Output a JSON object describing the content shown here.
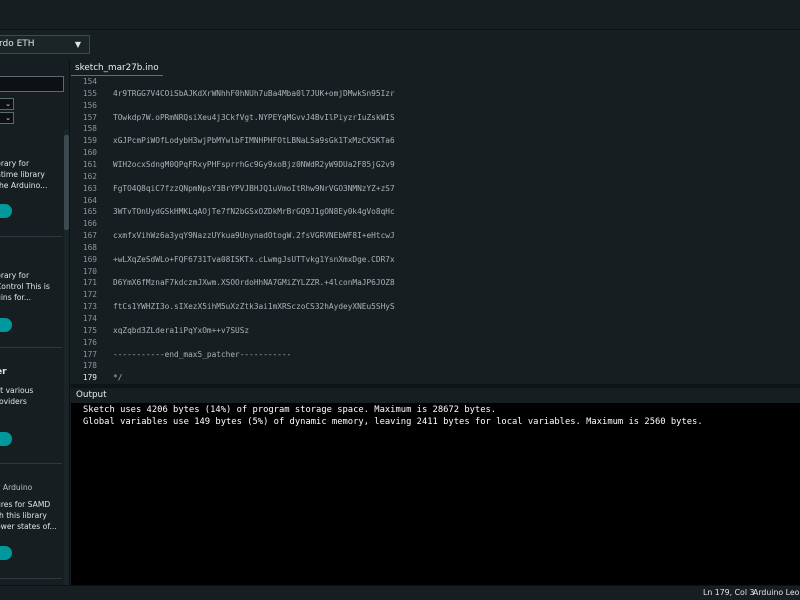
{
  "toolbar": {
    "board_selector": "rdo ETH"
  },
  "sidebar": {
    "filter_options": [
      "",
      ""
    ],
    "cards": [
      {
        "lines": [
          "brary for",
          "ntime library",
          "the Arduino..."
        ]
      },
      {
        "lines": [
          "brary for",
          "Control This is",
          "gins for..."
        ]
      },
      {
        "title": "er",
        "lines": [
          "ct various",
          "roviders"
        ]
      },
      {
        "subtitle": "y Arduino",
        "lines": [
          "ures for SAMD",
          "th this library",
          "ower states of..."
        ]
      }
    ]
  },
  "editor": {
    "tab_name": "sketch_mar27b.ino",
    "lines": [
      {
        "num": "154",
        "code": ""
      },
      {
        "num": "155",
        "code": "4r9TRGG7V4COiSbAJKdXrWNhhF0hNUh7uBa4Mba0l7JUK+omjDMwkSn95Izr"
      },
      {
        "num": "156",
        "code": ""
      },
      {
        "num": "157",
        "code": "TOwkdp7W.oPRmNRQsiXeu4j3CkfVgt.NYPEYqMGvvJ4BvIlPiyzrIuZskWIS"
      },
      {
        "num": "158",
        "code": ""
      },
      {
        "num": "159",
        "code": "xGJPcmPiWOfLodybH3wjPbMYwlbFIMNHPHFOtLBNaLSa9sGk1TxMzCXSKTa6"
      },
      {
        "num": "160",
        "code": ""
      },
      {
        "num": "161",
        "code": "WIH2ocxSdngM0QPqFRxyPHFsprrhGc9Gy9xoBjz0NWdR2yW9DUa2F85jG2v9"
      },
      {
        "num": "162",
        "code": ""
      },
      {
        "num": "163",
        "code": "FgTO4Q8qiC7fzzQNpmNpsY3BrYPVJBHJQ1uVmoItRhw9NrVGO3NMNzYZ+zS7"
      },
      {
        "num": "164",
        "code": ""
      },
      {
        "num": "165",
        "code": "3WTvTOnUydGSkHMKLqAOjTe7fN2bGSxOZDkMrBrGQ9J1gON8Ey0k4gVo8qHc"
      },
      {
        "num": "166",
        "code": ""
      },
      {
        "num": "167",
        "code": "cxmfxVihWz6a3yqY9NazzUYkua9UnynadOtogW.2fsVGRVNEbWF8I+eHtcwJ"
      },
      {
        "num": "168",
        "code": ""
      },
      {
        "num": "169",
        "code": "+wLXqZeSdWLo+FQF6731Tva08ISKTx.cLwmgJsUTTvkg1YsnXmxDge.CDR7x"
      },
      {
        "num": "170",
        "code": ""
      },
      {
        "num": "171",
        "code": "D6YmX6fMznaF7kdczmJXwm.XSOOrdoHhNA7GMiZYLZZR.+4lconMaJP6JOZ8"
      },
      {
        "num": "172",
        "code": ""
      },
      {
        "num": "173",
        "code": "ftCs1YWHZI3o.sIXezX5ihM5uXzZtk3ai1mXRSczoCS32hAydeyXNEu5SHyS"
      },
      {
        "num": "174",
        "code": ""
      },
      {
        "num": "175",
        "code": "xqZqbd3ZLdera1iPqYxOm++v7SUSz"
      },
      {
        "num": "176",
        "code": ""
      },
      {
        "num": "177",
        "code": "-----------end_max5_patcher-----------"
      },
      {
        "num": "178",
        "code": ""
      },
      {
        "num": "179",
        "code": "*/"
      }
    ]
  },
  "output": {
    "label": "Output",
    "lines": [
      "Sketch uses 4206 bytes (14%) of program storage space. Maximum is 28672 bytes.",
      "Global variables use 149 bytes (5%) of dynamic memory, leaving 2411 bytes for local variables. Maximum is 2560 bytes."
    ]
  },
  "status": {
    "cursor": "Ln 179, Col 3",
    "board": "Arduino Leon"
  },
  "colors": {
    "background": "#171e21",
    "accent": "#00979d",
    "console": "#000000"
  },
  "icons": {
    "board_dropdown": "chevron-down-icon"
  }
}
